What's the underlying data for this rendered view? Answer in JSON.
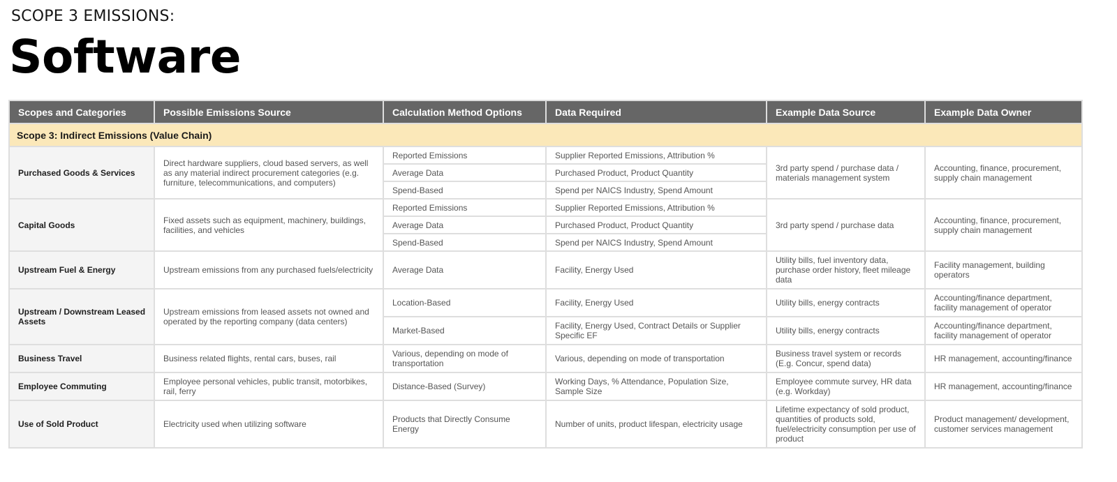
{
  "page": {
    "subtitle": "SCOPE 3 EMISSIONS:",
    "title": "Software"
  },
  "table": {
    "headers": [
      "Scopes and Categories",
      "Possible Emissions Source",
      "Calculation Method Options",
      "Data Required",
      "Example Data Source",
      "Example Data Owner"
    ],
    "scope_row": "Scope 3: Indirect Emissions (Value Chain)",
    "rows": [
      {
        "category": "Purchased Goods & Services",
        "source": "Direct hardware suppliers, cloud based servers, as well as any material indirect procurement categories (e.g. furniture, telecommunications, and computers)",
        "methods": [
          {
            "method": "Reported Emissions",
            "data": "Supplier Reported Emissions, Attribution %"
          },
          {
            "method": "Average Data",
            "data": "Purchased Product, Product Quantity"
          },
          {
            "method": "Spend-Based",
            "data": "Spend per NAICS Industry, Spend Amount"
          }
        ],
        "data_source": "3rd party spend / purchase data / materials management system",
        "data_owner": "Accounting, finance,  procurement, supply chain management"
      },
      {
        "category": "Capital Goods",
        "source": "Fixed assets such as equipment, machinery, buildings, facilities, and vehicles",
        "methods": [
          {
            "method": "Reported Emissions",
            "data": "Supplier Reported Emissions, Attribution %"
          },
          {
            "method": "Average Data",
            "data": "Purchased Product, Product Quantity"
          },
          {
            "method": "Spend-Based",
            "data": "Spend per NAICS Industry, Spend Amount"
          }
        ],
        "data_source": "3rd party spend / purchase data",
        "data_owner": "Accounting, finance,  procurement, supply chain management"
      },
      {
        "category": "Upstream Fuel & Energy",
        "source": "Upstream emissions from any purchased fuels/electricity",
        "method": "Average Data",
        "data": "Facility, Energy Used",
        "data_source": "Utility bills, fuel inventory data, purchase order history, fleet mileage data",
        "data_owner": "Facility management, building operators"
      },
      {
        "category": "Upstream / Downstream Leased Assets",
        "source": "Upstream emissions from leased assets not owned and operated by the reporting company (data centers)",
        "methods": [
          {
            "method": "Location-Based",
            "data": "Facility, Energy Used",
            "data_source": "Utility bills, energy contracts",
            "data_owner": "Accounting/finance department, facility management of operator"
          },
          {
            "method": "Market-Based",
            "data": "Facility, Energy Used, Contract Details or Supplier Specific EF",
            "data_source": "Utility bills, energy contracts",
            "data_owner": "Accounting/finance department, facility management of operator"
          }
        ]
      },
      {
        "category": "Business Travel",
        "source": "Business related flights, rental cars, buses, rail",
        "method": "Various, depending on mode of transportation",
        "data": "Various, depending on mode of transportation",
        "data_source": "Business travel system or records (E.g. Concur, spend data)",
        "data_owner": "HR management, accounting/finance"
      },
      {
        "category": "Employee Commuting",
        "source": "Employee personal vehicles, public transit, motorbikes, rail, ferry",
        "method": "Distance-Based (Survey)",
        "data": "Working Days, % Attendance, Population Size, Sample Size",
        "data_source": "Employee commute survey, HR data (e.g. Workday)",
        "data_owner": "HR management, accounting/finance"
      },
      {
        "category": "Use of Sold Product",
        "source": "Electricity used when utilizing software",
        "method": "Products that Directly Consume Energy",
        "data": "Number of units, product lifespan, electricity usage",
        "data_source": "Lifetime expectancy of sold product, quantities of products sold, fuel/electricity consumption per use of product",
        "data_owner": "Product management/ development, customer services management"
      }
    ]
  },
  "colors": {
    "header_bg": "#666666",
    "scope_row_bg": "#fbe8b9",
    "category_bg": "#f4f4f4",
    "border": "#dedede",
    "body_text": "#555555"
  }
}
